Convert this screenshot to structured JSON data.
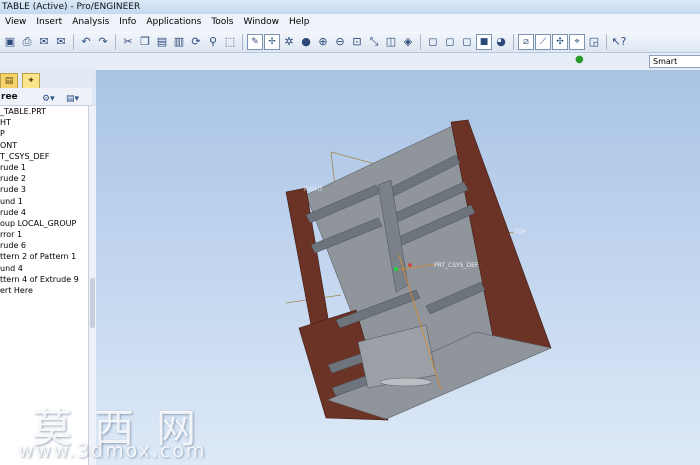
{
  "window": {
    "title": "TABLE (Active) - Pro/ENGINEER"
  },
  "menu": [
    "View",
    "Insert",
    "Analysis",
    "Info",
    "Applications",
    "Tools",
    "Window",
    "Help"
  ],
  "toolbar": {
    "icons": [
      "save-icon",
      "print-icon",
      "email-icon",
      "email-link-icon",
      "undo-icon",
      "redo-icon",
      "cut-icon",
      "copy-icon",
      "paste-icon",
      "paste-special-icon",
      "regenerate-icon",
      "find-icon",
      "select-box-icon",
      "repaint-icon",
      "spin-center-icon",
      "orient-icon",
      "shading-icon",
      "zoom-in-icon",
      "zoom-out-icon",
      "refit-icon",
      "reorient-icon",
      "saved-views-icon",
      "layers-icon",
      "wireframe-icon",
      "hidden-line-icon",
      "no-hidden-icon",
      "shaded-icon",
      "appearance-icon",
      "datum-planes-icon",
      "datum-axes-icon",
      "datum-points-icon",
      "csys-icon",
      "whats-this-icon"
    ]
  },
  "filter": {
    "smart_label": "Smart"
  },
  "tree": {
    "header": "ree",
    "items": [
      "_TABLE.PRT",
      "HT",
      "P",
      "ONT",
      "T_CSYS_DEF",
      "rude 1",
      "rude 2",
      "rude 3",
      "und 1",
      "rude 4",
      "oup LOCAL_GROUP",
      "rror 1",
      "rude 6",
      "ttern 2 of Pattern 1",
      "und 4",
      "ttern 4 of Extrude 9",
      "ert Here"
    ]
  },
  "viewport": {
    "labels": {
      "right": "RIGHT",
      "top": "TOP",
      "csys": "PRT_CSYS_DEF"
    }
  },
  "watermark": {
    "cn": "莫西网",
    "url": "www.3dmox.com"
  },
  "colors": {
    "wood": "#6b3226",
    "panel": "#8f959b",
    "shelf": "#6d747b"
  }
}
